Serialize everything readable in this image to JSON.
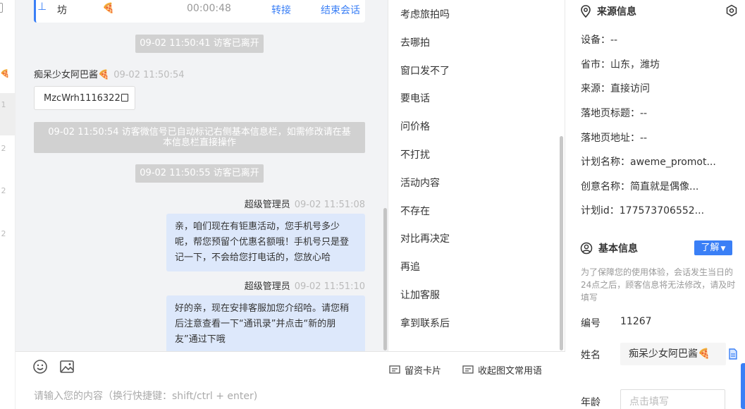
{
  "left_strip": {
    "items": [
      "1",
      "2",
      "2",
      "2"
    ]
  },
  "chat": {
    "top_card": {
      "arrow": "⊥",
      "city": "坊",
      "duration": "00:00:48",
      "transfer": "转接",
      "end": "结束会话"
    },
    "messages": [
      {
        "type": "system",
        "text": "09-02 11:50:41 访客已离开"
      },
      {
        "type": "visitor",
        "sender": "痴呆少女阿巴酱",
        "time": "09-02 11:50:54",
        "card": "MzcWrh1116322"
      },
      {
        "type": "system_block",
        "text": "09-02 11:50:54 访客微信号已自动标记右侧基本信息栏，如需修改请在基本信息栏直接操作"
      },
      {
        "type": "system",
        "text": "09-02 11:50:55 访客已离开"
      },
      {
        "type": "agent",
        "sender": "超级管理员",
        "time": "09-02 11:51:08",
        "text": "亲，咱们现在有钜惠活动，您手机号多少呢，帮您预留个优惠名额哦！手机号只是登记一下，不会给您打电话的，您放心哈"
      },
      {
        "type": "agent",
        "sender": "超级管理员",
        "time": "09-02 11:51:10",
        "text": "好的亲，现在安排客服加您介绍哈。请您稍后注意查看一下“通讯录”并点击“新的朋友”通过下哦"
      }
    ]
  },
  "toolbar": {
    "card_label": "留资卡片",
    "collapse_label": "收起图文常用语",
    "input_placeholder": "请输入您的内容（换行快捷键：shift/ctrl + enter)"
  },
  "phrases": [
    "考虑旅拍吗",
    "去哪拍",
    "窗口发不了",
    "要电话",
    "问价格",
    "不打扰",
    "活动内容",
    "不存在",
    "对比再决定",
    "再追",
    "让加客服",
    "拿到联系后"
  ],
  "source_info": {
    "title": "来源信息",
    "rows": [
      "设备：--",
      "省市：山东，潍坊",
      "来源：直接访问",
      "落地页标题：--",
      "落地页地址：--",
      "计划名称：aweme_promot...",
      "创意名称：简直就是偶像...",
      "计划id：177573706552..."
    ]
  },
  "basic_info": {
    "title": "基本信息",
    "learn_button": "了解",
    "notice": "为了保障您的使用体验，会话发生当日的24点之后，顾客信息将无法修改，请及时填写",
    "id_label": "编号",
    "id_value": "11267",
    "name_label": "姓名",
    "name_value": "痴呆少女阿巴酱",
    "age_label": "年龄",
    "age_placeholder": "点击填写"
  },
  "colors": {
    "accent": "#3a7ff6",
    "bubble": "#dde8fb",
    "system_pill": "#d1d1d1"
  }
}
